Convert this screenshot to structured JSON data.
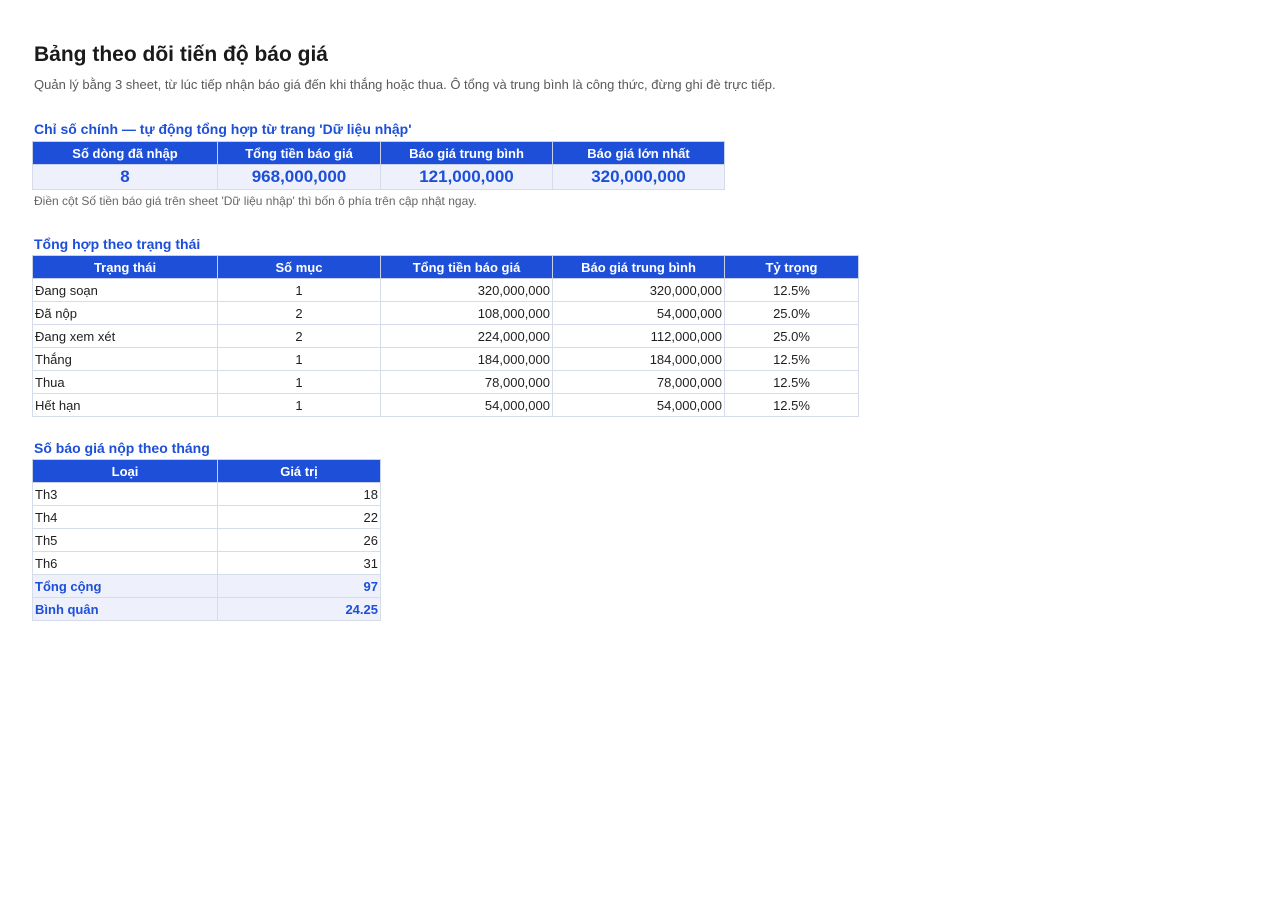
{
  "header": {
    "title": "Bảng theo dõi tiến độ báo giá",
    "subtitle": "Quản lý bằng 3 sheet, từ lúc tiếp nhận báo giá đến khi thắng hoặc thua. Ô tổng và trung bình là công thức, đừng ghi đè trực tiếp."
  },
  "kpi": {
    "title": "Chỉ số chính — tự động tổng hợp từ trang 'Dữ liệu nhập'",
    "headers": [
      "Số dòng đã nhập",
      "Tổng tiền báo giá",
      "Báo giá trung bình",
      "Báo giá lớn nhất"
    ],
    "values": [
      "8",
      "968,000,000",
      "121,000,000",
      "320,000,000"
    ],
    "note": "Điền cột Số tiền báo giá trên sheet 'Dữ liệu nhập' thì bốn ô phía trên cập nhật ngay."
  },
  "status_summary": {
    "title": "Tổng hợp theo trạng thái",
    "headers": [
      "Trạng thái",
      "Số mục",
      "Tổng tiền báo giá",
      "Báo giá trung bình",
      "Tỷ trọng"
    ],
    "rows": [
      [
        "Đang soạn",
        "1",
        "320,000,000",
        "320,000,000",
        "12.5%"
      ],
      [
        "Đã nộp",
        "2",
        "108,000,000",
        "54,000,000",
        "25.0%"
      ],
      [
        "Đang xem xét",
        "2",
        "224,000,000",
        "112,000,000",
        "25.0%"
      ],
      [
        "Thắng",
        "1",
        "184,000,000",
        "184,000,000",
        "12.5%"
      ],
      [
        "Thua",
        "1",
        "78,000,000",
        "78,000,000",
        "12.5%"
      ],
      [
        "Hết hạn",
        "1",
        "54,000,000",
        "54,000,000",
        "12.5%"
      ]
    ]
  },
  "monthly": {
    "title": "Số báo giá nộp theo tháng",
    "headers": [
      "Loại",
      "Giá trị"
    ],
    "rows": [
      [
        "Th3",
        "18"
      ],
      [
        "Th4",
        "22"
      ],
      [
        "Th5",
        "26"
      ],
      [
        "Th6",
        "31"
      ]
    ],
    "total": [
      "Tổng cộng",
      "97"
    ],
    "average": [
      "Bình quân",
      "24.25"
    ]
  },
  "colors": {
    "header_fill": "#1d4fd8",
    "accent_text": "#1d4fd8",
    "highlight_fill": "#eef1fb"
  }
}
